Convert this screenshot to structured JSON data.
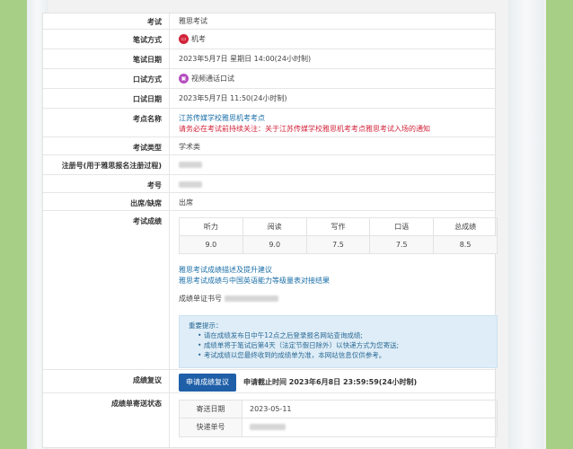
{
  "rows": {
    "exam": {
      "label": "考试",
      "value": "雅思考试"
    },
    "written_mode": {
      "label": "笔试方式",
      "value": "机考",
      "icon": "computer-icon"
    },
    "written_date": {
      "label": "笔试日期",
      "value": "2023年5月7日 星期日 14:00(24小时制)"
    },
    "oral_mode": {
      "label": "口试方式",
      "value": "视频通话口试",
      "icon": "video-call-icon"
    },
    "oral_date": {
      "label": "口试日期",
      "value": "2023年5月7日 11:50(24小时制)"
    },
    "center": {
      "label": "考点名称",
      "name_link": "江苏传媒学校雅思机考考点",
      "notice": "请务必在考试前持续关注：关于江苏传媒学校雅思机考考点雅思考试入场的通知"
    },
    "exam_type": {
      "label": "考试类型",
      "value": "学术类"
    },
    "reg_no": {
      "label": "注册号(用于雅思报名注册过程)"
    },
    "exam_no": {
      "label": "考号"
    },
    "attendance": {
      "label": "出席/缺席",
      "value": "出席"
    },
    "scores": {
      "label": "考试成绩",
      "headers": [
        "听力",
        "阅读",
        "写作",
        "口语",
        "总成绩"
      ],
      "values": [
        "9.0",
        "9.0",
        "7.5",
        "7.5",
        "8.5"
      ],
      "link1": "雅思考试成绩描述及提升建议",
      "link2": "雅思考试成绩与中国英语能力等级量表对接结果",
      "certificate_label": "成绩单证书号",
      "notice_title": "重要提示：",
      "notice_items": [
        "请在成绩发布日中午12点之后登录报名网站查询成绩;",
        "成绩单将于笔试后第4天（法定节假日除外）以快递方式为您寄送;",
        "考试成绩以您最终收到的成绩单为准，本网站信息仅供参考。"
      ]
    },
    "review": {
      "label": "成绩复议",
      "button": "申请成绩复议",
      "deadline": "申请截止时间 2023年6月8日 23:59:59(24小时制)"
    },
    "mail": {
      "label": "成绩单寄送状态",
      "send_date_label": "寄送日期",
      "send_date": "2023-05-11",
      "tracking_label": "快递单号"
    }
  }
}
